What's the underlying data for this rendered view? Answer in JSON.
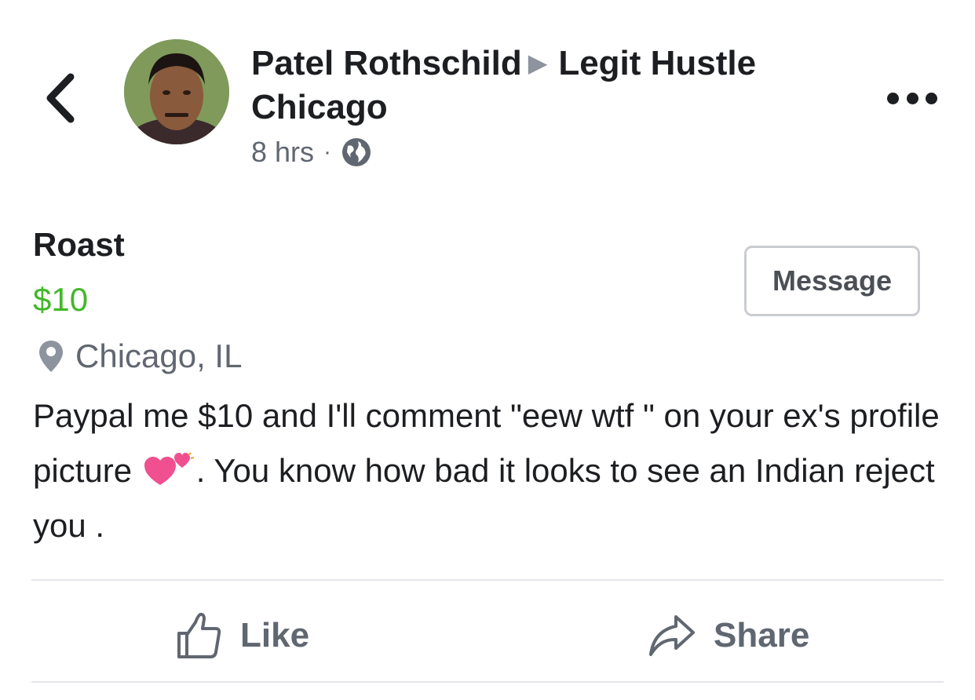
{
  "header": {
    "author": "Patel Rothschild",
    "group": "Legit Hustle Chicago",
    "time": "8 hrs",
    "separator": "·",
    "privacy_icon": "globe-icon",
    "back_icon": "chevron-left-icon",
    "more_icon": "more-options-icon"
  },
  "listing": {
    "title": "Roast",
    "price": "$10",
    "location": "Chicago, IL",
    "location_icon": "location-pin-icon",
    "message_button": "Message",
    "description_before": "Paypal me $10 and I'll comment  \"eew wtf \" on your ex's profile picture ",
    "description_emoji": "two-hearts-emoji",
    "description_after": ". You know how bad it looks to see an Indian reject you ."
  },
  "actions": {
    "like": "Like",
    "like_icon": "thumbs-up-icon",
    "share": "Share",
    "share_icon": "share-arrow-icon"
  },
  "colors": {
    "price": "#42b72a",
    "text": "#1c1e21",
    "muted": "#616770",
    "divider": "#e4e6eb"
  }
}
